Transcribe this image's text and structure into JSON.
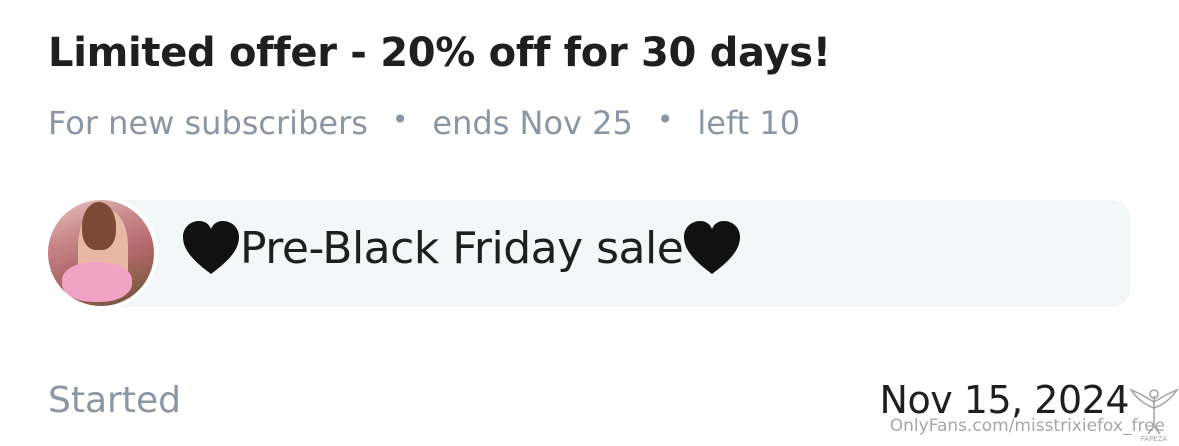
{
  "offer": {
    "title": "Limited offer - 20% off for 30 days!",
    "audience": "For new subscribers",
    "separator": "•",
    "ends": "ends Nov 25",
    "left": "left 10"
  },
  "message": {
    "text": "Pre-Black Friday sale",
    "icons": [
      "black-heart-icon",
      "black-heart-icon"
    ]
  },
  "started": {
    "label": "Started",
    "date": "Nov 15, 2024"
  },
  "watermark": {
    "text": "OnlyFans.com/misstrixiefox_free",
    "logo_text": "FAPEZA"
  },
  "colors": {
    "title": "#1f1f1f",
    "muted": "#8a96a3",
    "bubble": "#f4f7f8",
    "heart": "#111111"
  }
}
